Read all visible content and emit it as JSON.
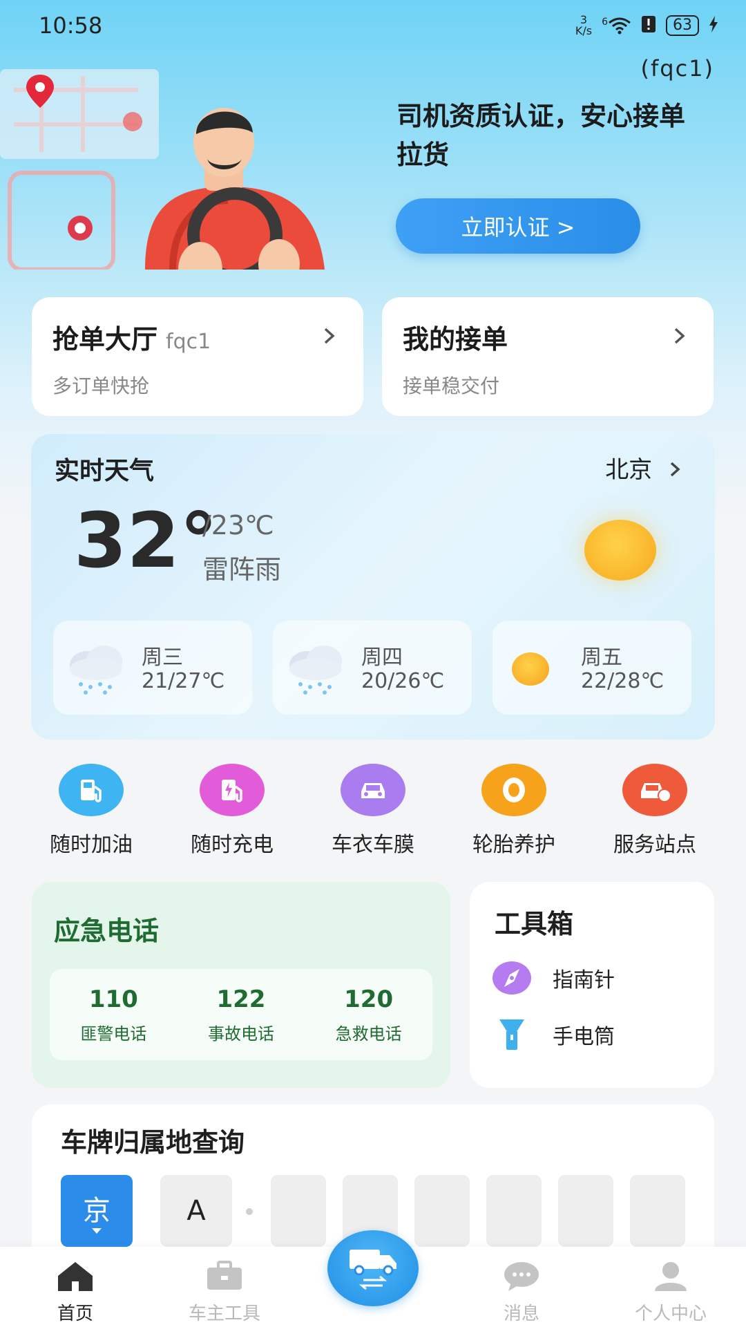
{
  "status_bar": {
    "time": "10:58",
    "net_speed_value": "3",
    "net_speed_unit": "K/s",
    "signal_label": "6",
    "battery": "63"
  },
  "header": {
    "user_id": "(fqc1)",
    "hero_text": "司机资质认证，安心接单拉货",
    "cert_button": "立即认证 >"
  },
  "quick_cards": [
    {
      "title": "抢单大厅",
      "tag": "fqc1",
      "subtitle": "多订单快抢"
    },
    {
      "title": "我的接单",
      "tag": "",
      "subtitle": "接单稳交付"
    }
  ],
  "weather": {
    "title": "实时天气",
    "city": "北京",
    "temp": "32°",
    "low": "/23℃",
    "desc": "雷阵雨",
    "forecast": [
      {
        "day": "周三",
        "temp": "21/27℃",
        "icon": "rain-cloud-icon"
      },
      {
        "day": "周四",
        "temp": "20/26℃",
        "icon": "rain-cloud-icon"
      },
      {
        "day": "周五",
        "temp": "22/28℃",
        "icon": "sun-icon"
      }
    ]
  },
  "services": [
    {
      "label": "随时加油",
      "icon": "fuel-pump-icon",
      "color": "#3fb4f2"
    },
    {
      "label": "随时充电",
      "icon": "charger-icon",
      "color": "#e25bd9"
    },
    {
      "label": "车衣车膜",
      "icon": "car-wrap-icon",
      "color": "#a97cf0"
    },
    {
      "label": "轮胎养护",
      "icon": "tire-icon",
      "color": "#f6a21a"
    },
    {
      "label": "服务站点",
      "icon": "car-service-icon",
      "color": "#ef5a3b"
    }
  ],
  "emergency": {
    "title": "应急电话",
    "items": [
      {
        "number": "110",
        "label": "匪警电话"
      },
      {
        "number": "122",
        "label": "事故电话"
      },
      {
        "number": "120",
        "label": "急救电话"
      }
    ]
  },
  "toolbox": {
    "title": "工具箱",
    "items": [
      {
        "label": "指南针",
        "icon": "compass-icon"
      },
      {
        "label": "手电筒",
        "icon": "flashlight-icon"
      }
    ]
  },
  "plate": {
    "title": "车牌归属地查询",
    "province": "京",
    "letter": "A"
  },
  "nav": {
    "items": [
      {
        "label": "首页",
        "icon": "home-icon"
      },
      {
        "label": "车主工具",
        "icon": "toolbox-icon"
      },
      {
        "label": "消息",
        "icon": "message-icon"
      },
      {
        "label": "个人中心",
        "icon": "user-icon"
      }
    ],
    "center_icon": "truck-icon"
  },
  "colors": {
    "primary_blue": "#2b8de9",
    "emergency_green": "#1f6b31",
    "sun_yellow": "#f7a91d"
  }
}
